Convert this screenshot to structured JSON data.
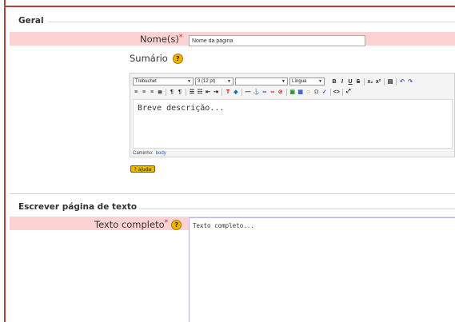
{
  "sections": {
    "general": {
      "legend": "Geral"
    },
    "text_page": {
      "legend": "Escrever página de texto"
    }
  },
  "name_field": {
    "label": "Nome(s)",
    "required_mark": "*",
    "value": "Nome da página"
  },
  "summary_field": {
    "label": "Sumário",
    "help_icon": "help-icon"
  },
  "editor": {
    "font_family": "Trebuchet",
    "font_size": "3 (12 pt)",
    "style": "",
    "language": "Língua",
    "content": "Breve descrição...",
    "path_label": "Caminho:",
    "path_value": "body",
    "help_badge": "? ajuda",
    "toolbar_row1": [
      "B",
      "I",
      "U",
      "S"
    ],
    "toolbar_icons": [
      "align-left-icon",
      "align-center-icon",
      "align-right-icon",
      "justify-icon",
      "ltr-icon",
      "rtl-icon",
      "ordered-list-icon",
      "unordered-list-icon",
      "outdent-icon",
      "indent-icon",
      "text-color-icon",
      "bg-color-icon",
      "hr-icon",
      "anchor-icon",
      "link-icon",
      "unlink-icon",
      "nolink-icon",
      "image-icon",
      "table-icon",
      "smiley-icon",
      "special-char-icon",
      "spellcheck-icon",
      "html-source-icon",
      "fullscreen-icon"
    ]
  },
  "full_text_field": {
    "label": "Texto completo",
    "required_mark": "*",
    "value": "Texto completo..."
  },
  "colors": {
    "required_row_bg": "#fcd2d2",
    "frame_accent": "#b3413f",
    "help_yellow": "#f0b400",
    "link_blue": "#3355cc"
  }
}
